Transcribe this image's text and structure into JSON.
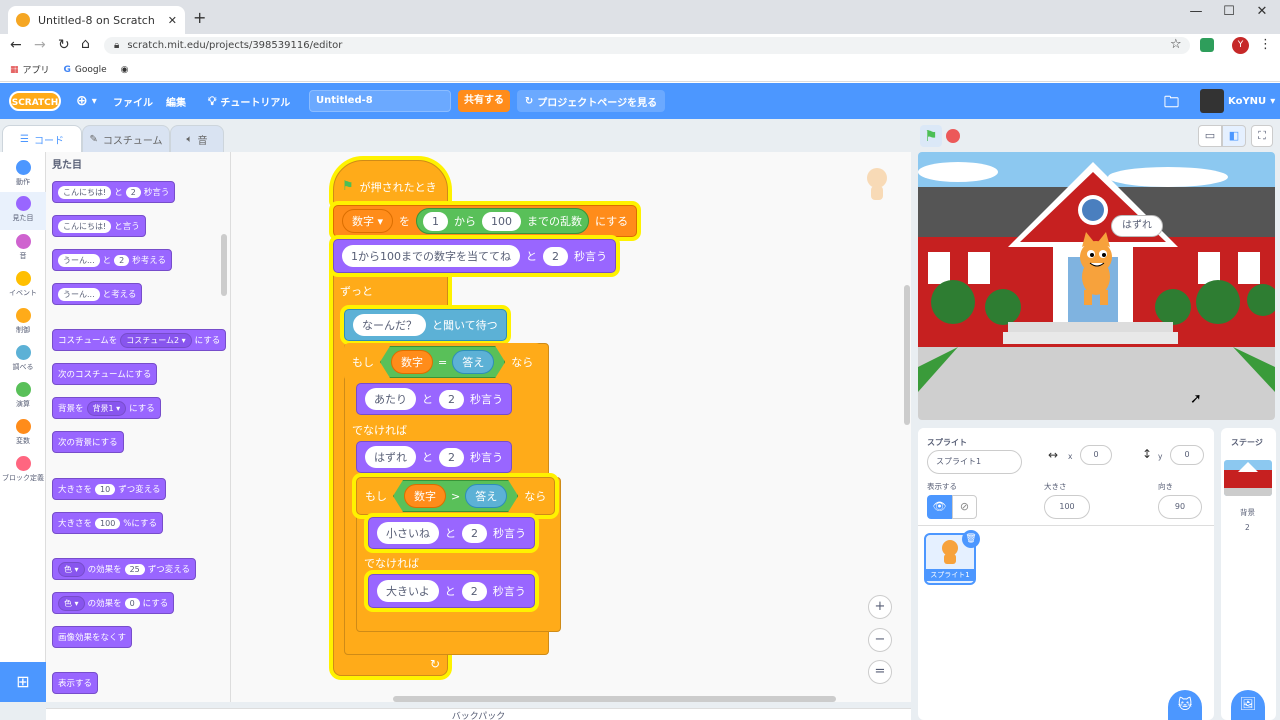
{
  "browser": {
    "tab_title": "Untitled-8 on Scratch",
    "new_tab": "+",
    "url": "scratch.mit.edu/projects/398539116/editor",
    "bookmarks": [
      "アプリ",
      "Google"
    ],
    "profile": "Y"
  },
  "menu": {
    "logo": "SCRATCH",
    "file": "ファイル",
    "edit": "編集",
    "tutorials": "チュートリアル",
    "project_title": "Untitled-8",
    "share": "共有する",
    "see_project_page": "プロジェクトページを見る",
    "user": "KoYNU"
  },
  "tabs": {
    "code": "コード",
    "costumes": "コスチューム",
    "sounds": "音"
  },
  "categories": [
    {
      "label": "動作",
      "color": "#4c97ff"
    },
    {
      "label": "見た目",
      "color": "#9966ff"
    },
    {
      "label": "音",
      "color": "#cf63cf"
    },
    {
      "label": "イベント",
      "color": "#ffbf00"
    },
    {
      "label": "制御",
      "color": "#ffab19"
    },
    {
      "label": "調べる",
      "color": "#5cb1d6"
    },
    {
      "label": "演算",
      "color": "#59c059"
    },
    {
      "label": "変数",
      "color": "#ff8c1a"
    },
    {
      "label": "ブロック定義",
      "color": "#ff6680"
    }
  ],
  "palette": {
    "heading": "見た目",
    "say_for": {
      "pre": "こんにちは!",
      "mid": "と",
      "num": "2",
      "post": "秒言う"
    },
    "say": {
      "pre": "こんにちは!",
      "post": "と言う"
    },
    "think_for": {
      "pre": "うーん...",
      "mid": "と",
      "num": "2",
      "post": "秒考える"
    },
    "think": {
      "pre": "うーん...",
      "post": "と考える"
    },
    "switch_costume": {
      "pre": "コスチュームを",
      "dd": "コスチューム2 ▾",
      "post": "にする"
    },
    "next_costume": "次のコスチュームにする",
    "switch_backdrop": {
      "pre": "背景を",
      "dd": "背景1 ▾",
      "post": "にする"
    },
    "next_backdrop": "次の背景にする",
    "change_size": {
      "pre": "大きさを",
      "num": "10",
      "post": "ずつ変える"
    },
    "set_size": {
      "pre": "大きさを",
      "num": "100",
      "post": "%にする"
    },
    "change_effect": {
      "dd": "色 ▾",
      "pre": "の効果を",
      "num": "25",
      "post": "ずつ変える"
    },
    "set_effect": {
      "dd": "色 ▾",
      "pre": "の効果を",
      "num": "0",
      "post": "にする"
    },
    "clear_effects": "画像効果をなくす",
    "show": "表示する"
  },
  "script": {
    "hat": "が押されたとき",
    "set_var": {
      "var": "数字 ▾",
      "to": "を",
      "from": "1",
      "kara": "から",
      "max": "100",
      "made": "までの乱数",
      "suru": "にする"
    },
    "say1": {
      "text": "1から100までの数字を当ててね",
      "to": "と",
      "secs": "2",
      "post": "秒言う"
    },
    "forever": "ずっと",
    "ask": {
      "text": "なーんだ？",
      "post": "と聞いて待つ"
    },
    "if1": {
      "moshi": "もし",
      "left": "数字",
      "op": "=",
      "right": "答え",
      "nara": "なら"
    },
    "say_hit": {
      "text": "あたり",
      "to": "と",
      "secs": "2",
      "post": "秒言う"
    },
    "else1": "でなければ",
    "say_miss": {
      "text": "はずれ",
      "to": "と",
      "secs": "2",
      "post": "秒言う"
    },
    "if2": {
      "moshi": "もし",
      "left": "数字",
      "op": ">",
      "right": "答え",
      "nara": "なら"
    },
    "say_small": {
      "text": "小さいね",
      "to": "と",
      "secs": "2",
      "post": "秒言う"
    },
    "else2": "でなければ",
    "say_big": {
      "text": "大きいよ",
      "to": "と",
      "secs": "2",
      "post": "秒言う"
    },
    "loop_arrow": "↻"
  },
  "zoom": {
    "in": "+",
    "out": "−",
    "reset": "="
  },
  "backpack": "バックパック",
  "stage": {
    "speech": "はずれ"
  },
  "sprite_panel": {
    "sprite_label": "スプライト",
    "sprite_name": "スプライト1",
    "x_label": "x",
    "x": "0",
    "y_label": "y",
    "y": "0",
    "show_label": "表示する",
    "size_label": "大きさ",
    "size": "100",
    "direction_label": "向き",
    "direction": "90",
    "thumb_name": "スプライト1"
  },
  "stage_panel": {
    "label": "ステージ",
    "backdrops_label": "背景",
    "backdrops_count": "2"
  }
}
